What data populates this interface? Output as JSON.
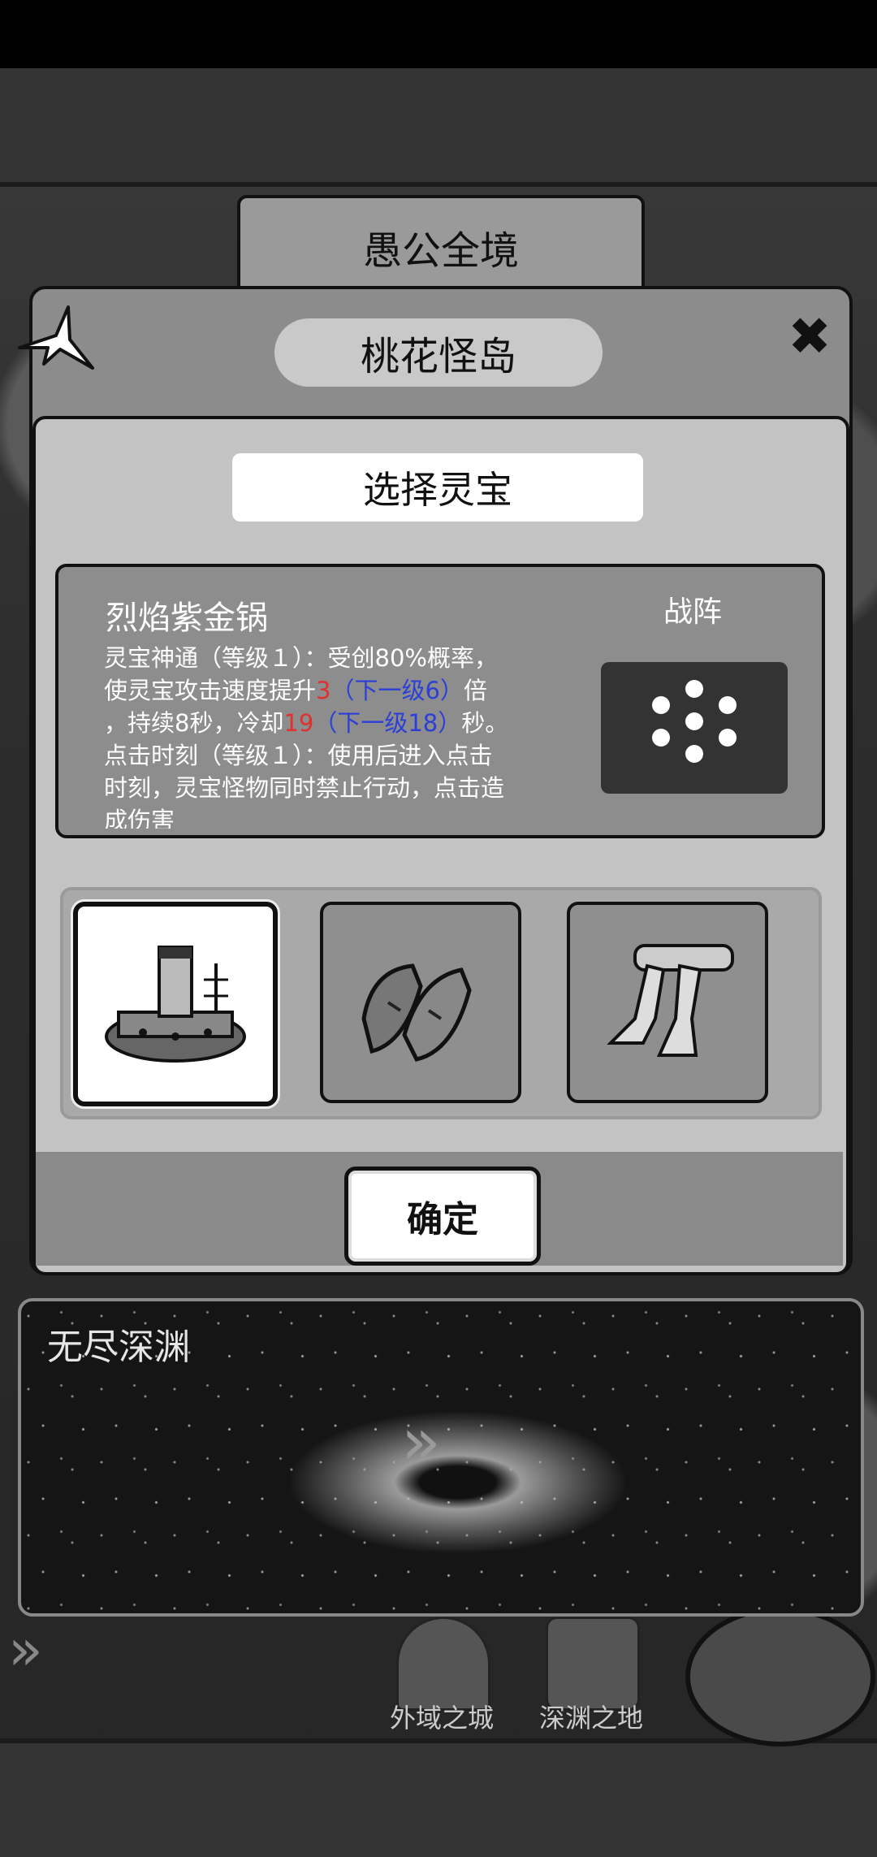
{
  "area_tab": "愚公全境",
  "dialog": {
    "title": "桃花怪岛",
    "panel_title": "选择灵宝",
    "item_name": "烈焰紫金锅",
    "desc": {
      "l1": "灵宝神通（等级１）：受创80%概率，",
      "l2_a": "使灵宝攻击速度提升",
      "l2_val": "3",
      "l2_next": "（下一级6）",
      "l2_b": "倍",
      "l3_a": "，持续8秒，冷却",
      "l3_val": "19",
      "l3_next": "（下一级18）",
      "l3_b": "秒。",
      "l4": "点击时刻（等级１）：使用后进入点击",
      "l5": "时刻，灵宝怪物同时禁止行动，点击造",
      "l6": "成伤害"
    },
    "formation_label": "战阵",
    "items": [
      {
        "icon": "hotpot-ship-icon",
        "selected": true
      },
      {
        "icon": "shoes-icon",
        "selected": false
      },
      {
        "icon": "armored-legs-icon",
        "selected": false
      }
    ],
    "confirm_label": "确定"
  },
  "abyss": {
    "title": "无尽深渊"
  },
  "nav": {
    "outer_city": "外域之城",
    "abyss_land": "深渊之地"
  },
  "colors": {
    "highlight_red": "#e03030",
    "next_level_blue": "#2b3fd8"
  }
}
